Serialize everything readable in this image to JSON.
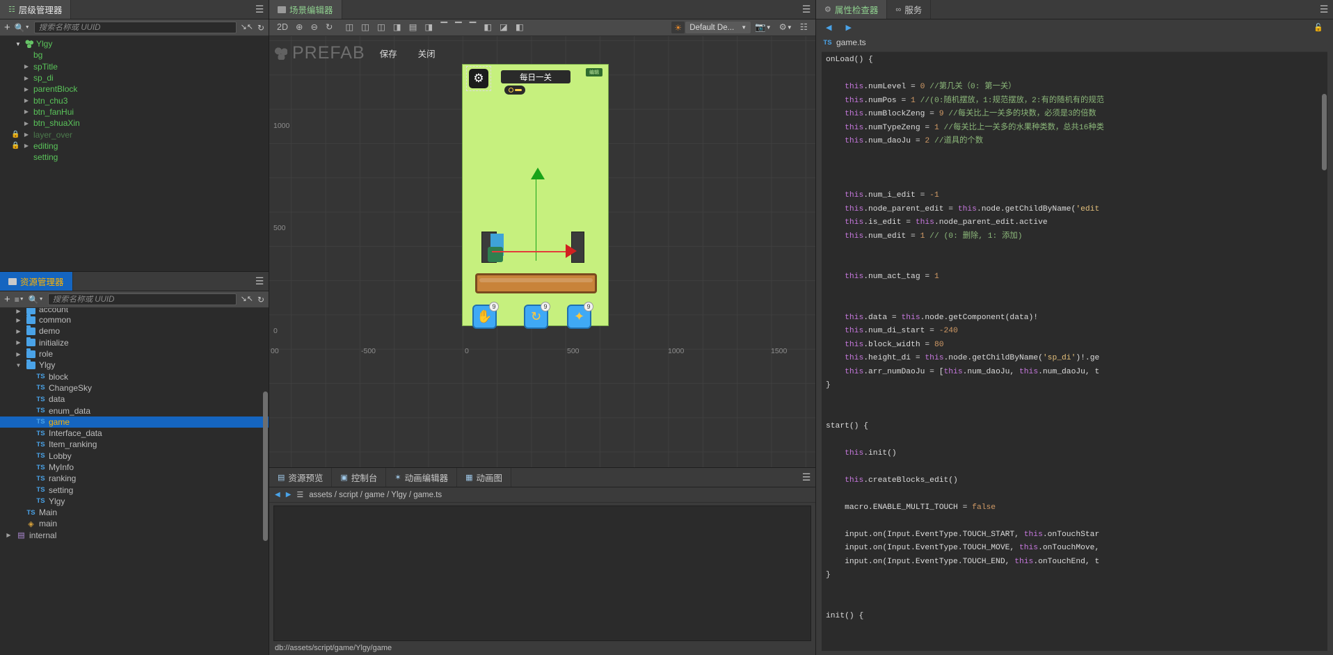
{
  "hierarchy": {
    "tab_label": "层级管理器",
    "tab_icon": "hierarchy-icon",
    "menu_icon": "hamburger-icon",
    "toolbar": {
      "add_label": "+",
      "search_icon": "search-icon",
      "search_placeholder": "搜索名称或 UUID",
      "collapse_icon": "collapse-icon",
      "refresh_icon": "refresh-icon"
    },
    "nodes": [
      {
        "label": "Ylgy",
        "depth": 0,
        "arrow": "open",
        "icon": "prefab-icon",
        "locked": false,
        "dim": false
      },
      {
        "label": "bg",
        "depth": 1,
        "arrow": "none",
        "icon": "",
        "locked": false,
        "dim": false
      },
      {
        "label": "spTitle",
        "depth": 1,
        "arrow": "closed",
        "icon": "",
        "locked": false,
        "dim": false
      },
      {
        "label": "sp_di",
        "depth": 1,
        "arrow": "closed",
        "icon": "",
        "locked": false,
        "dim": false
      },
      {
        "label": "parentBlock",
        "depth": 1,
        "arrow": "closed",
        "icon": "",
        "locked": false,
        "dim": false
      },
      {
        "label": "btn_chu3",
        "depth": 1,
        "arrow": "closed",
        "icon": "",
        "locked": false,
        "dim": false
      },
      {
        "label": "btn_fanHui",
        "depth": 1,
        "arrow": "closed",
        "icon": "",
        "locked": false,
        "dim": false
      },
      {
        "label": "btn_shuaXin",
        "depth": 1,
        "arrow": "closed",
        "icon": "",
        "locked": false,
        "dim": false
      },
      {
        "label": "layer_over",
        "depth": 1,
        "arrow": "closed",
        "icon": "",
        "locked": true,
        "dim": true
      },
      {
        "label": "editing",
        "depth": 1,
        "arrow": "closed",
        "icon": "",
        "locked": true,
        "dim": false
      },
      {
        "label": "setting",
        "depth": 1,
        "arrow": "none",
        "icon": "",
        "locked": false,
        "dim": false
      }
    ]
  },
  "assets": {
    "tab_label": "资源管理器",
    "tab_icon": "folder-icon",
    "menu_icon": "hamburger-icon",
    "toolbar": {
      "add_label": "+",
      "sort_icon": "sort-icon",
      "search_icon": "search-icon",
      "search_placeholder": "搜索名称或 UUID",
      "collapse_icon": "collapse-icon",
      "refresh_icon": "refresh-icon"
    },
    "items": [
      {
        "label": "account",
        "type": "folder",
        "depth": 1,
        "arrow": "closed",
        "selected": false,
        "clipped": true
      },
      {
        "label": "common",
        "type": "folder",
        "depth": 1,
        "arrow": "closed",
        "selected": false
      },
      {
        "label": "demo",
        "type": "folder",
        "depth": 1,
        "arrow": "closed",
        "selected": false
      },
      {
        "label": "initialize",
        "type": "folder",
        "depth": 1,
        "arrow": "closed",
        "selected": false
      },
      {
        "label": "role",
        "type": "folder",
        "depth": 1,
        "arrow": "closed",
        "selected": false
      },
      {
        "label": "Ylgy",
        "type": "folder",
        "depth": 1,
        "arrow": "open",
        "selected": false
      },
      {
        "label": "block",
        "type": "ts",
        "depth": 2,
        "arrow": "none",
        "selected": false
      },
      {
        "label": "ChangeSky",
        "type": "ts",
        "depth": 2,
        "arrow": "none",
        "selected": false
      },
      {
        "label": "data",
        "type": "ts",
        "depth": 2,
        "arrow": "none",
        "selected": false
      },
      {
        "label": "enum_data",
        "type": "ts",
        "depth": 2,
        "arrow": "none",
        "selected": false
      },
      {
        "label": "game",
        "type": "ts",
        "depth": 2,
        "arrow": "none",
        "selected": true
      },
      {
        "label": "Interface_data",
        "type": "ts",
        "depth": 2,
        "arrow": "none",
        "selected": false
      },
      {
        "label": "Item_ranking",
        "type": "ts",
        "depth": 2,
        "arrow": "none",
        "selected": false
      },
      {
        "label": "Lobby",
        "type": "ts",
        "depth": 2,
        "arrow": "none",
        "selected": false
      },
      {
        "label": "MyInfo",
        "type": "ts",
        "depth": 2,
        "arrow": "none",
        "selected": false
      },
      {
        "label": "ranking",
        "type": "ts",
        "depth": 2,
        "arrow": "none",
        "selected": false
      },
      {
        "label": "setting",
        "type": "ts",
        "depth": 2,
        "arrow": "none",
        "selected": false
      },
      {
        "label": "Ylgy",
        "type": "ts",
        "depth": 2,
        "arrow": "none",
        "selected": false
      },
      {
        "label": "Main",
        "type": "ts",
        "depth": 1,
        "arrow": "none",
        "selected": false
      },
      {
        "label": "main",
        "type": "js",
        "depth": 1,
        "arrow": "none",
        "selected": false
      },
      {
        "label": "internal",
        "type": "db",
        "depth": 0,
        "arrow": "closed",
        "selected": false
      }
    ]
  },
  "scene": {
    "tab_label": "场景编辑器",
    "tab_icon": "scene-icon",
    "menu_icon": "hamburger-icon",
    "toolbar": {
      "mode_2d": "2D",
      "zoom_in_icon": "zoom-in-icon",
      "zoom_out_icon": "zoom-out-icon",
      "reset_icon": "reset-icon",
      "align_icons": [
        "align-left-icon",
        "align-center-h-icon",
        "align-right-icon",
        "align-top-icon",
        "align-middle-v-icon",
        "align-bottom-icon",
        "distribute-top-icon",
        "distribute-middle-icon",
        "distribute-bottom-icon",
        "distribute-h-icon",
        "distribute-v-icon",
        "distribute-both-icon"
      ],
      "gizmo_icon": "sun-icon",
      "device_value": "Default De...",
      "camera_icon": "camera-icon",
      "settings_icon": "gear-icon",
      "layout_icon": "layout-icon"
    },
    "prefab_bar": {
      "title": "PREFAB",
      "save_label": "保存",
      "close_label": "关闭"
    },
    "rulers": {
      "vertical": [
        "1000",
        "500",
        "0"
      ],
      "horizontal": [
        "00",
        "-500",
        "0",
        "500",
        "1000",
        "1500"
      ]
    },
    "game": {
      "gear_icon": "gear-icon",
      "title_label": "每日一关",
      "badge_label": "编辑",
      "tools": [
        {
          "icon": "hand-icon",
          "count": "9"
        },
        {
          "icon": "refresh-icon",
          "count": "9"
        },
        {
          "icon": "run-icon",
          "count": "9"
        }
      ]
    }
  },
  "dock": {
    "tabs": [
      {
        "label": "资源预览",
        "icon": "preview-icon",
        "active": false
      },
      {
        "label": "控制台",
        "icon": "console-icon",
        "active": false
      },
      {
        "label": "动画编辑器",
        "icon": "anim-icon",
        "active": false
      },
      {
        "label": "动画图",
        "icon": "animgraph-icon",
        "active": false
      }
    ],
    "menu_icon": "hamburger-icon",
    "breadcrumb": {
      "back_icon": "arrow-left-icon",
      "forward_icon": "arrow-right-icon",
      "file_icon": "script-icon",
      "path": "assets / script / game / Ylgy / game.ts"
    },
    "status": "db://assets/script/game/Ylgy/game"
  },
  "inspector": {
    "tabs": [
      {
        "label": "属性检查器",
        "icon": "gear-icon",
        "active": true
      },
      {
        "label": "服务",
        "icon": "link-icon",
        "active": false
      }
    ],
    "menu_icon": "hamburger-icon",
    "nav": {
      "back_icon": "arrow-left-icon",
      "forward_icon": "arrow-right-icon",
      "lock_icon": "unlock-icon"
    },
    "file": {
      "type_badge": "TS",
      "name": "game.ts"
    },
    "code_lines": [
      {
        "tokens": [
          {
            "t": "onLoad() {",
            "c": "k-white"
          }
        ],
        "indent": 0
      },
      {
        "tokens": [],
        "indent": 0
      },
      {
        "tokens": [
          {
            "t": "this",
            "c": "k-this"
          },
          {
            "t": ".numLevel = ",
            "c": "k-white"
          },
          {
            "t": "0",
            "c": "k-num"
          },
          {
            "t": " //第几关（0: 第一关）",
            "c": "k-com"
          }
        ],
        "indent": 1
      },
      {
        "tokens": [
          {
            "t": "this",
            "c": "k-this"
          },
          {
            "t": ".numPos = ",
            "c": "k-white"
          },
          {
            "t": "1",
            "c": "k-num"
          },
          {
            "t": " //(0:随机摆放，1:规范摆放，2:有的随机有的规范",
            "c": "k-com"
          }
        ],
        "indent": 1
      },
      {
        "tokens": [
          {
            "t": "this",
            "c": "k-this"
          },
          {
            "t": ".numBlockZeng = ",
            "c": "k-white"
          },
          {
            "t": "9",
            "c": "k-num"
          },
          {
            "t": " //每关比上一关多的块数，必须是3的倍数",
            "c": "k-com"
          }
        ],
        "indent": 1
      },
      {
        "tokens": [
          {
            "t": "this",
            "c": "k-this"
          },
          {
            "t": ".numTypeZeng = ",
            "c": "k-white"
          },
          {
            "t": "1",
            "c": "k-num"
          },
          {
            "t": " //每关比上一关多的水果种类数，总共16种类",
            "c": "k-com"
          }
        ],
        "indent": 1
      },
      {
        "tokens": [
          {
            "t": "this",
            "c": "k-this"
          },
          {
            "t": ".num_daoJu = ",
            "c": "k-white"
          },
          {
            "t": "2",
            "c": "k-num"
          },
          {
            "t": " //道具的个数",
            "c": "k-com"
          }
        ],
        "indent": 1
      },
      {
        "tokens": [],
        "indent": 0
      },
      {
        "tokens": [],
        "indent": 0
      },
      {
        "tokens": [],
        "indent": 0
      },
      {
        "tokens": [
          {
            "t": "this",
            "c": "k-this"
          },
          {
            "t": ".num_i_edit = ",
            "c": "k-white"
          },
          {
            "t": "-1",
            "c": "k-num"
          }
        ],
        "indent": 1
      },
      {
        "tokens": [
          {
            "t": "this",
            "c": "k-this"
          },
          {
            "t": ".node_parent_edit = ",
            "c": "k-white"
          },
          {
            "t": "this",
            "c": "k-this"
          },
          {
            "t": ".node.getChildByName(",
            "c": "k-white"
          },
          {
            "t": "'edit",
            "c": "k-str"
          }
        ],
        "indent": 1
      },
      {
        "tokens": [
          {
            "t": "this",
            "c": "k-this"
          },
          {
            "t": ".is_edit = ",
            "c": "k-white"
          },
          {
            "t": "this",
            "c": "k-this"
          },
          {
            "t": ".node_parent_edit.active",
            "c": "k-white"
          }
        ],
        "indent": 1
      },
      {
        "tokens": [
          {
            "t": "this",
            "c": "k-this"
          },
          {
            "t": ".num_edit = ",
            "c": "k-white"
          },
          {
            "t": "1",
            "c": "k-num"
          },
          {
            "t": " // (0: 删除, 1: 添加)",
            "c": "k-com"
          }
        ],
        "indent": 1
      },
      {
        "tokens": [],
        "indent": 0
      },
      {
        "tokens": [],
        "indent": 0
      },
      {
        "tokens": [
          {
            "t": "this",
            "c": "k-this"
          },
          {
            "t": ".num_act_tag = ",
            "c": "k-white"
          },
          {
            "t": "1",
            "c": "k-num"
          }
        ],
        "indent": 1
      },
      {
        "tokens": [],
        "indent": 0
      },
      {
        "tokens": [],
        "indent": 0
      },
      {
        "tokens": [
          {
            "t": "this",
            "c": "k-this"
          },
          {
            "t": ".data = ",
            "c": "k-white"
          },
          {
            "t": "this",
            "c": "k-this"
          },
          {
            "t": ".node.getComponent(data)!",
            "c": "k-white"
          }
        ],
        "indent": 1
      },
      {
        "tokens": [
          {
            "t": "this",
            "c": "k-this"
          },
          {
            "t": ".num_di_start = ",
            "c": "k-white"
          },
          {
            "t": "-240",
            "c": "k-num"
          }
        ],
        "indent": 1
      },
      {
        "tokens": [
          {
            "t": "this",
            "c": "k-this"
          },
          {
            "t": ".block_width = ",
            "c": "k-white"
          },
          {
            "t": "80",
            "c": "k-num"
          }
        ],
        "indent": 1
      },
      {
        "tokens": [
          {
            "t": "this",
            "c": "k-this"
          },
          {
            "t": ".height_di = ",
            "c": "k-white"
          },
          {
            "t": "this",
            "c": "k-this"
          },
          {
            "t": ".node.getChildByName(",
            "c": "k-white"
          },
          {
            "t": "'sp_di'",
            "c": "k-str"
          },
          {
            "t": ")!.ge",
            "c": "k-white"
          }
        ],
        "indent": 1
      },
      {
        "tokens": [
          {
            "t": "this",
            "c": "k-this"
          },
          {
            "t": ".arr_numDaoJu = [",
            "c": "k-white"
          },
          {
            "t": "this",
            "c": "k-this"
          },
          {
            "t": ".num_daoJu, ",
            "c": "k-white"
          },
          {
            "t": "this",
            "c": "k-this"
          },
          {
            "t": ".num_daoJu, t",
            "c": "k-white"
          }
        ],
        "indent": 1
      },
      {
        "tokens": [
          {
            "t": "}",
            "c": "k-brace"
          }
        ],
        "indent": 0
      },
      {
        "tokens": [],
        "indent": 0
      },
      {
        "tokens": [],
        "indent": 0
      },
      {
        "tokens": [
          {
            "t": "start() {",
            "c": "k-white"
          }
        ],
        "indent": 0
      },
      {
        "tokens": [],
        "indent": 0
      },
      {
        "tokens": [
          {
            "t": "this",
            "c": "k-this"
          },
          {
            "t": ".init()",
            "c": "k-white"
          }
        ],
        "indent": 1
      },
      {
        "tokens": [],
        "indent": 0
      },
      {
        "tokens": [
          {
            "t": "this",
            "c": "k-this"
          },
          {
            "t": ".createBlocks_edit()",
            "c": "k-white"
          }
        ],
        "indent": 1
      },
      {
        "tokens": [],
        "indent": 0
      },
      {
        "tokens": [
          {
            "t": "macro.ENABLE_MULTI_TOUCH = ",
            "c": "k-white"
          },
          {
            "t": "false",
            "c": "k-num"
          }
        ],
        "indent": 1
      },
      {
        "tokens": [],
        "indent": 0
      },
      {
        "tokens": [
          {
            "t": "input.on(Input.EventType.TOUCH_START, ",
            "c": "k-white"
          },
          {
            "t": "this",
            "c": "k-this"
          },
          {
            "t": ".onTouchStar",
            "c": "k-white"
          }
        ],
        "indent": 1
      },
      {
        "tokens": [
          {
            "t": "input.on(Input.EventType.TOUCH_MOVE, ",
            "c": "k-white"
          },
          {
            "t": "this",
            "c": "k-this"
          },
          {
            "t": ".onTouchMove,",
            "c": "k-white"
          }
        ],
        "indent": 1
      },
      {
        "tokens": [
          {
            "t": "input.on(Input.EventType.TOUCH_END, ",
            "c": "k-white"
          },
          {
            "t": "this",
            "c": "k-this"
          },
          {
            "t": ".onTouchEnd, t",
            "c": "k-white"
          }
        ],
        "indent": 1
      },
      {
        "tokens": [
          {
            "t": "}",
            "c": "k-brace"
          }
        ],
        "indent": 0
      },
      {
        "tokens": [],
        "indent": 0
      },
      {
        "tokens": [],
        "indent": 0
      },
      {
        "tokens": [
          {
            "t": "init() {",
            "c": "k-white"
          }
        ],
        "indent": 0
      }
    ]
  }
}
